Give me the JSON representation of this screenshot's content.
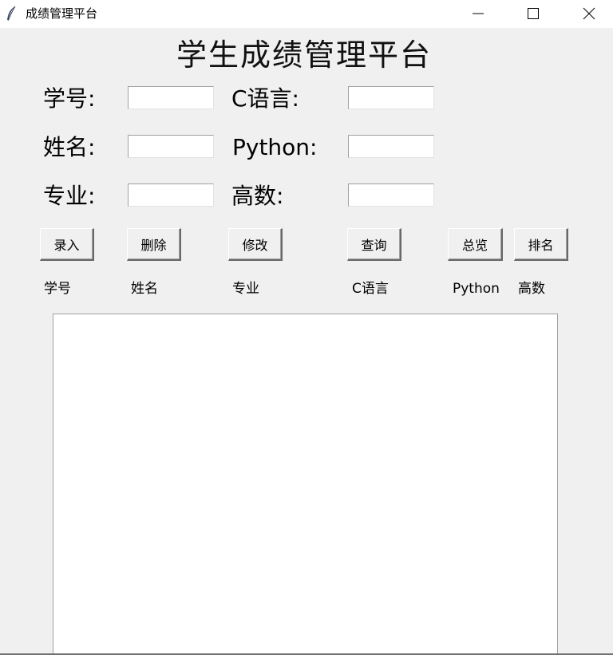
{
  "window": {
    "title": "成绩管理平台",
    "icon": "feather-icon",
    "controls": [
      "minimize-icon",
      "maximize-icon",
      "close-icon"
    ]
  },
  "heading": "学生成绩管理平台",
  "form": {
    "student_id_label": "学号:",
    "name_label": "姓名:",
    "major_label": "专业:",
    "c_lang_label": "C语言:",
    "python_label": "Python:",
    "math_label": "高数:",
    "student_id_value": "",
    "name_value": "",
    "major_value": "",
    "c_lang_value": "",
    "python_value": "",
    "math_value": ""
  },
  "buttons": {
    "add": "录入",
    "delete": "删除",
    "modify": "修改",
    "query": "查询",
    "overview": "总览",
    "rank": "排名"
  },
  "columns": [
    "学号",
    "姓名",
    "专业",
    "C语言",
    "Python",
    "高数"
  ],
  "colors": {
    "background": "#f0f0f0",
    "titlebar": "#ffffff",
    "input_bg": "#ffffff"
  }
}
